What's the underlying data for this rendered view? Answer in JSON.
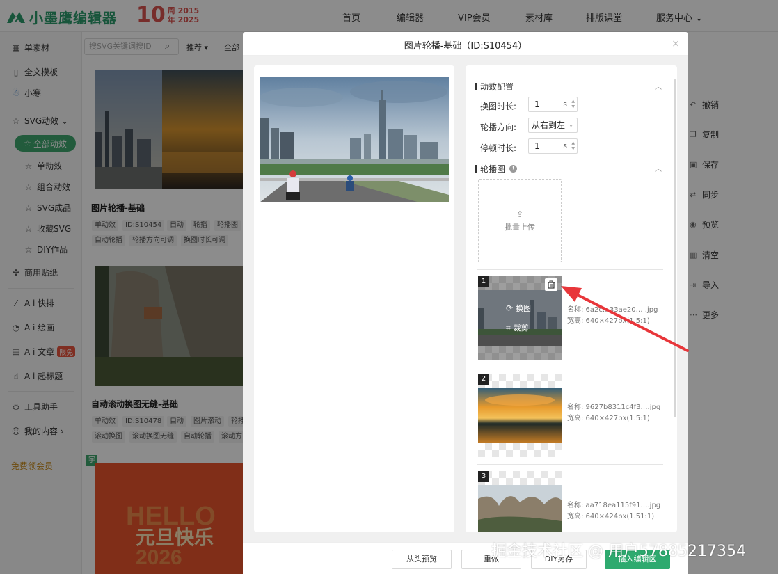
{
  "header": {
    "logo_text": "小墨鹰编辑器",
    "anniv_number": "10",
    "anniv_line1": "周 2015",
    "anniv_line2": "年 2025",
    "nav": [
      "首页",
      "编辑器",
      "VIP会员",
      "素材库",
      "排版课堂",
      "服务中心 ⌄"
    ]
  },
  "sidebar": {
    "items": {
      "single": "单素材",
      "template": "全文模板",
      "xiaohan": "小寒",
      "svg": "SVG动效 ⌄",
      "all": "全部动效",
      "single_fx": "单动效",
      "combo_fx": "组合动效",
      "svg_done": "SVG成品",
      "fav_svg": "收藏SVG",
      "diy": "DIY作品",
      "sticker": "商用贴纸",
      "ai_layout": "A i 快排",
      "ai_draw": "A i 绘画",
      "ai_article": "A i 文章",
      "ai_article_badge": "限免",
      "ai_title": "A i 起标题",
      "tools": "工具助手",
      "mine": "我的内容 ›",
      "free_vip": "免费领会员"
    }
  },
  "content": {
    "search_placeholder": "搜SVG关键词搜ID",
    "filter_sort": "推荐 ▾",
    "filter_all": "全部",
    "card1": {
      "title": "图片轮播-基础",
      "tags": [
        "单动效",
        "ID:S10454",
        "自动",
        "轮播",
        "轮播图",
        "自动轮播",
        "轮播方向可调",
        "换图时长可调"
      ]
    },
    "card2": {
      "title": "自动滚动换图无缝-基础",
      "tags": [
        "单动效",
        "ID:S10478",
        "自动",
        "图片滚动",
        "轮播",
        "滚动换图",
        "滚动换图无缝",
        "自动轮播",
        "滚动方"
      ]
    },
    "card3_text": "元旦快乐",
    "card3_big": "HELLO",
    "card3_year": "2026",
    "card3_badge": "字"
  },
  "tools": [
    "撤销",
    "复制",
    "保存",
    "同步",
    "预览",
    "清空",
    "导入",
    "更多"
  ],
  "modal": {
    "title": "图片轮播-基础（ID:S10454）",
    "close": "×",
    "config": {
      "section1": "动效配置",
      "switch_label": "换图时长:",
      "switch_value": "1",
      "switch_unit": "s",
      "direction_label": "轮播方向:",
      "direction_value": "从右到左",
      "pause_label": "停顿时长:",
      "pause_value": "1",
      "pause_unit": "s",
      "section2": "轮播图",
      "upload_label": "批量上传"
    },
    "slides": [
      {
        "num": "1",
        "name": "名称:  6a2c…33ae20…  .jpg",
        "size": "宽高:  640×427px(1.5:1)",
        "replace": "换图",
        "crop": "裁剪"
      },
      {
        "num": "2",
        "name": "名称:  9627b8311c4f3….jpg",
        "size": "宽高:  640×427px(1.5:1)"
      },
      {
        "num": "3",
        "name": "名称:  aa718ea115f91….jpg",
        "size": "宽高:  640×424px(1.51:1)"
      }
    ],
    "footer": {
      "preview": "从头预览",
      "reset": "重做",
      "save_diy": "DIY另存",
      "insert": "插入编辑区"
    }
  },
  "watermark": "掘金技术社区 @ 用户57885217354",
  "colors": {
    "brand": "#2c9b6c",
    "primary_btn": "#2eaa6f",
    "arrow": "#e8363a"
  }
}
